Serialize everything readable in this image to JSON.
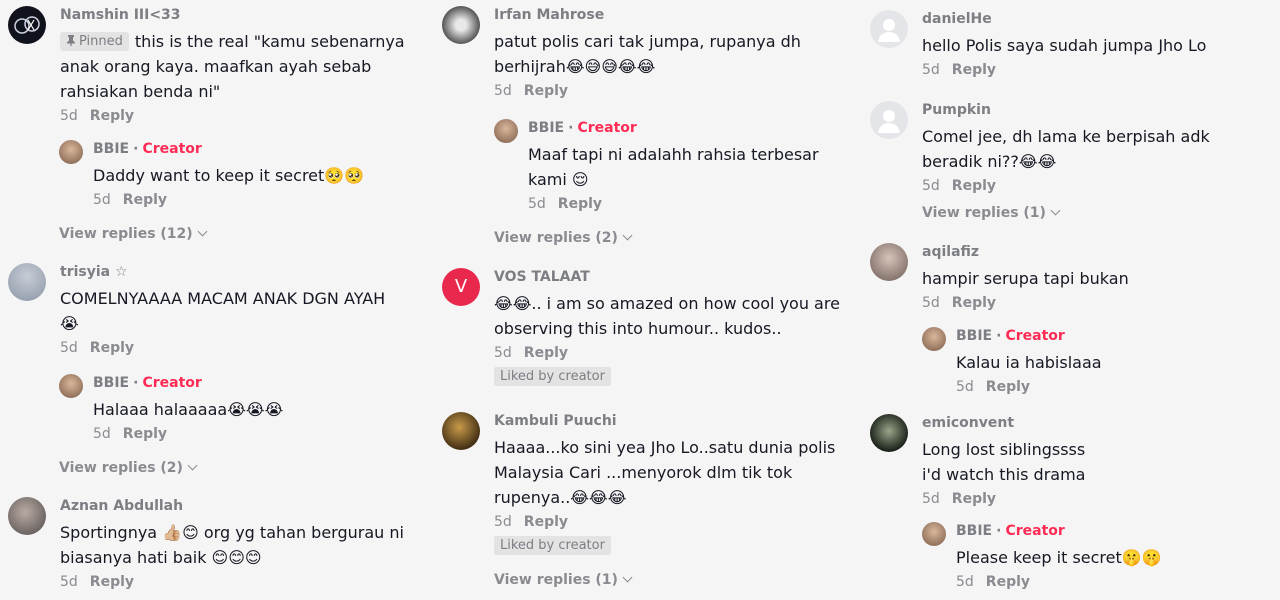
{
  "common": {
    "reply_label": "Reply",
    "creator_label": "Creator",
    "pinned_label": "Pinned",
    "liked_label": "Liked by creator",
    "sep": "·"
  },
  "col1": {
    "c1": {
      "user": "Namshin III<33",
      "text": "this is the real \"kamu sebenarnya anak orang kaya. maafkan ayah sebab rahsiakan benda ni\"",
      "time": "5d"
    },
    "r1": {
      "user": "BBIE",
      "text": "Daddy want to keep it secret🥺🥺",
      "time": "5d"
    },
    "vr1": "View replies (12)",
    "c2": {
      "user": "trisyia ☆",
      "text": "COMELNYAAAA MACAM ANAK DGN AYAH 😭",
      "time": "5d"
    },
    "r2": {
      "user": "BBIE",
      "text": "Halaaa halaaaaa😭😭😭",
      "time": "5d"
    },
    "vr2": "View replies (2)",
    "c3": {
      "user": "Aznan Abdullah",
      "text": "Sportingnya 👍🏼😊 org yg tahan bergurau ni biasanya hati baik 😊😊😊",
      "time": "5d"
    }
  },
  "col2": {
    "c1": {
      "user": "Irfan Mahrose",
      "text": "patut polis cari tak jumpa, rupanya dh berhijrah😂😅😅😂😂",
      "time": "5d"
    },
    "r1": {
      "user": "BBIE",
      "text": "Maaf tapi ni adalahh rahsia terbesar kami 😌",
      "time": "5d"
    },
    "vr1": "View replies (2)",
    "c2": {
      "user": "VOS TALAAT",
      "avatar_letter": "V",
      "text": "😂😂.. i am so amazed on how cool you are observing this into humour.. kudos..",
      "time": "5d"
    },
    "c3": {
      "user": "Kambuli Puuchi",
      "text": "Haaaa...ko sini yea Jho Lo..satu dunia polis Malaysia Cari ...menyorok dlm tik tok rupenya..😂😂😂",
      "time": "5d"
    },
    "vr2": "View replies (1)"
  },
  "col3": {
    "c1": {
      "user": "danielHe",
      "text": "hello Polis saya sudah jumpa Jho Lo",
      "time": "5d"
    },
    "c2": {
      "user": "Pumpkin",
      "text": "Comel jee, dh lama ke berpisah adk beradik ni??😂😂",
      "time": "5d"
    },
    "vr1": "View replies (1)",
    "c3": {
      "user": "aqilafiz",
      "text": "hampir serupa tapi bukan",
      "time": "5d"
    },
    "r1": {
      "user": "BBIE",
      "text": "Kalau ia habislaaa",
      "time": "5d"
    },
    "c4": {
      "user": "emiconvent",
      "text": "Long lost siblingssss\ni'd watch this drama",
      "time": "5d"
    },
    "r2": {
      "user": "BBIE",
      "text": "Please keep it secret🤫🤫",
      "time": "5d"
    }
  },
  "colors": {
    "creator": "#fe2c55",
    "muted": "#8a8b91",
    "v_avatar": "#e8294d",
    "background": "#f5f5f5"
  },
  "icons": [
    "pin-icon",
    "chevron-down-icon",
    "default-avatar-icon"
  ]
}
